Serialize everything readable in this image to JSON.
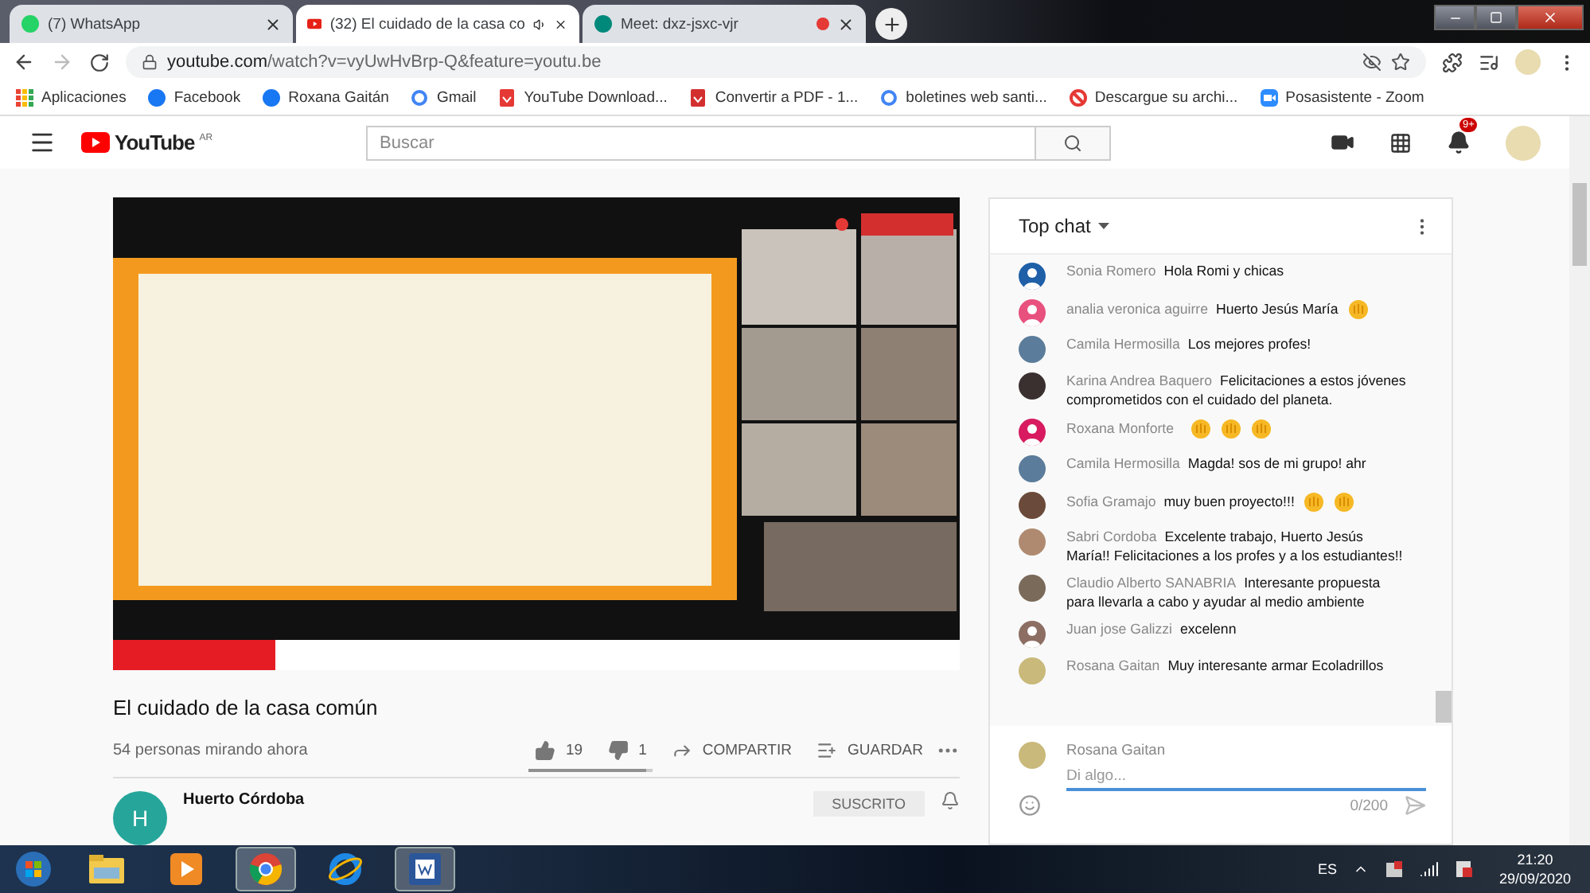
{
  "window": {
    "tabs": [
      {
        "title": "(7) WhatsApp",
        "kind": "whatsapp",
        "selected": false,
        "playing_audio": false,
        "recording": false
      },
      {
        "title": "(32) El cuidado de la casa co",
        "kind": "youtube",
        "selected": true,
        "playing_audio": true,
        "recording": false
      },
      {
        "title": "Meet: dxz-jsxc-vjr",
        "kind": "meet",
        "selected": false,
        "playing_audio": false,
        "recording": true
      }
    ]
  },
  "toolbar": {
    "forward_disabled": true,
    "url_host": "youtube.com",
    "url_path": "/watch?v=vyUwHvBrp-Q&feature=youtu.be"
  },
  "bookmarks": [
    {
      "label": "Aplicaciones",
      "kind": "apps"
    },
    {
      "label": "Facebook",
      "kind": "facebook"
    },
    {
      "label": "Roxana Gaitán",
      "kind": "facebook"
    },
    {
      "label": "Gmail",
      "kind": "google"
    },
    {
      "label": "YouTube Download...",
      "kind": "download"
    },
    {
      "label": "Convertir a PDF - 1...",
      "kind": "pdf"
    },
    {
      "label": "boletines web santi...",
      "kind": "google"
    },
    {
      "label": "Descargue su archi...",
      "kind": "block"
    },
    {
      "label": "Posasistente - Zoom",
      "kind": "zoom"
    }
  ],
  "header": {
    "logo_text": "YouTube",
    "region": "AR",
    "search": {
      "placeholder": "Buscar"
    },
    "notifications": "9+"
  },
  "video": {
    "title": "El cuidado de la casa común",
    "viewers": "54 personas mirando ahora",
    "likes": "19",
    "dislikes": "1",
    "share": "COMPARTIR",
    "save": "GUARDAR",
    "rating": {
      "level": 0.95
    }
  },
  "channel": {
    "initial": "H",
    "name": "Huerto Córdoba",
    "subscribe": "SUSCRITO"
  },
  "chat": {
    "title": "Top chat",
    "messages": [
      {
        "author": "Sonia Romero",
        "text": "Hola Romi y chicas",
        "avatar": {
          "kind": "silhouette",
          "color": "#1e5fa8"
        }
      },
      {
        "author": "analia veronica aguirre",
        "text": "Huerto Jesús María",
        "avatar": {
          "kind": "silhouette",
          "color": "#e8507e"
        },
        "emojis": [
          {
            "kind": "hand"
          }
        ]
      },
      {
        "author": "Camila Hermosilla",
        "text": "Los mejores profes!",
        "avatar": {
          "kind": "photo",
          "color": "#5b7c9a"
        }
      },
      {
        "author": "Karina Andrea Baquero",
        "text": "Felicitaciones a estos jóvenes comprometidos con el cuidado del planeta.",
        "avatar": {
          "kind": "photo",
          "color": "#3a3030"
        }
      },
      {
        "author": "Roxana Monforte",
        "avatar": {
          "kind": "silhouette",
          "color": "#d81b60"
        },
        "emojis": [
          {
            "kind": "hand"
          },
          {
            "kind": "hand"
          },
          {
            "kind": "hand"
          }
        ]
      },
      {
        "author": "Camila Hermosilla",
        "text": "Magda! sos de mi grupo! ahr",
        "avatar": {
          "kind": "photo",
          "color": "#5b7c9a"
        }
      },
      {
        "author": "Sofia Gramajo",
        "text": "muy buen proyecto!!!",
        "avatar": {
          "kind": "photo",
          "color": "#6a4a3a"
        },
        "emojis": [
          {
            "kind": "hand"
          },
          {
            "kind": "hand"
          }
        ]
      },
      {
        "author": "Sabri Cordoba",
        "text": "Excelente trabajo, Huerto Jesús María!! Felicitaciones a los profes y a los estudiantes!!",
        "avatar": {
          "kind": "photo",
          "color": "#b08a70"
        }
      },
      {
        "author": "Claudio Alberto SANABRIA",
        "text": "Interesante propuesta para llevarla a cabo y ayudar al medio ambiente",
        "avatar": {
          "kind": "photo",
          "color": "#7a6a5a"
        }
      },
      {
        "author": "Juan jose Galizzi",
        "text": "excelenn",
        "avatar": {
          "kind": "silhouette",
          "color": "#8d6e63"
        }
      },
      {
        "author": "Rosana Gaitan",
        "text": "Muy interesante armar Ecoladrillos",
        "avatar": {
          "kind": "photo",
          "color": "#c9b97a"
        }
      }
    ],
    "composer": {
      "author": "Rosana Gaitan",
      "placeholder": "Di algo...",
      "counter": "0/200"
    }
  },
  "taskbar": {
    "apps": [
      {
        "kind": "explorer",
        "selected": false
      },
      {
        "kind": "media",
        "selected": false
      },
      {
        "kind": "chrome",
        "selected": true
      },
      {
        "kind": "ie",
        "selected": false
      },
      {
        "kind": "word",
        "selected": true
      }
    ],
    "language": "ES",
    "time": "21:20",
    "date": "29/09/2020"
  }
}
